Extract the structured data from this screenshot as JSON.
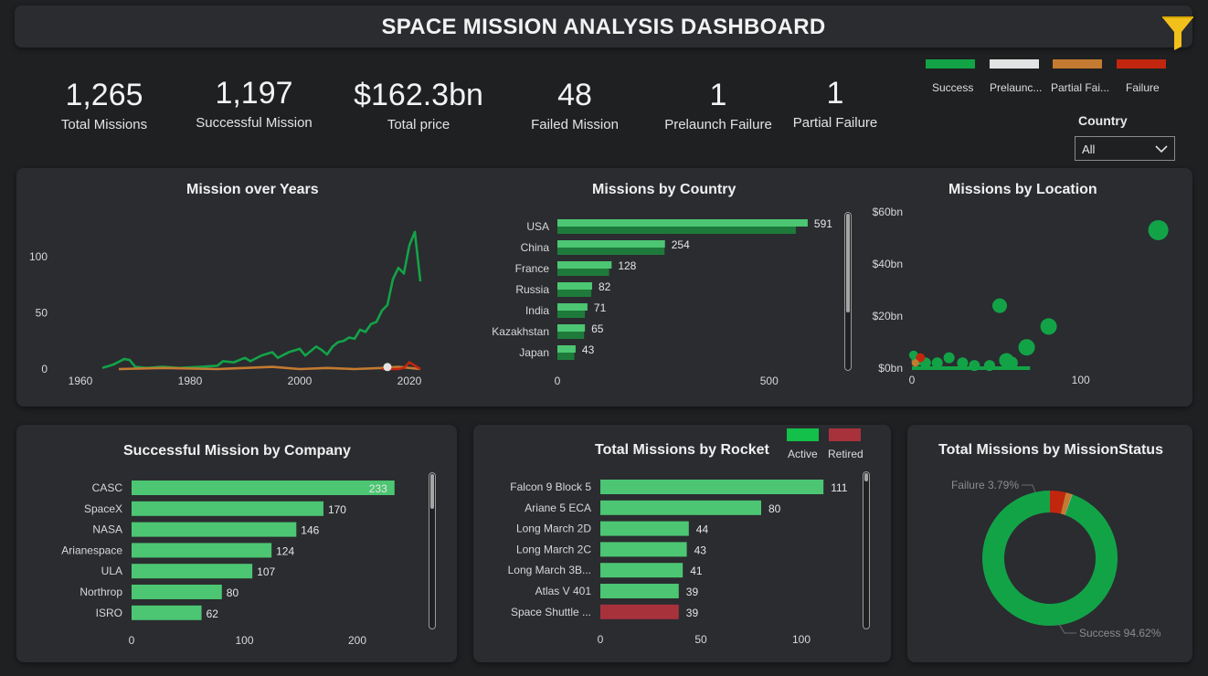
{
  "header": {
    "title": "SPACE MISSION ANALYSIS DASHBOARD"
  },
  "kpis": [
    {
      "value": "1,265",
      "label": "Total Missions"
    },
    {
      "value": "1,197",
      "label": "Successful Mission"
    },
    {
      "value": "$162.3bn",
      "label": "Total price"
    },
    {
      "value": "48",
      "label": "Failed Mission"
    },
    {
      "value": "1",
      "label": "Prelaunch Failure"
    },
    {
      "value": "1",
      "label": "Partial Failure"
    }
  ],
  "status_legend": [
    {
      "label": "Success",
      "color": "#13a347"
    },
    {
      "label": "Prelaunc...",
      "color": "#e3e3e3"
    },
    {
      "label": "Partial Fai...",
      "color": "#c47a30"
    },
    {
      "label": "Failure",
      "color": "#c2260f"
    }
  ],
  "slicer": {
    "label": "Country",
    "value": "All"
  },
  "colors": {
    "success": "#13a347",
    "bar_green": "#4cc672",
    "bar_dark": "#1e7a3a",
    "retired": "#a8323c",
    "failure": "#c2260f",
    "partial": "#c47a30"
  },
  "chart_data": [
    {
      "id": "mission_over_years",
      "type": "line",
      "title": "Mission over Years",
      "xticks": [
        "1960",
        "1980",
        "2000",
        "2020"
      ],
      "yticks": [
        "0",
        "50",
        "100"
      ],
      "xlim": [
        1960,
        2023
      ],
      "ylim": [
        0,
        130
      ],
      "series": [
        {
          "color": "#13a347",
          "x": [
            1964,
            1966,
            1968,
            1969,
            1970,
            1972,
            1975,
            1978,
            1982,
            1985,
            1986,
            1988,
            1990,
            1991,
            1993,
            1995,
            1996,
            1998,
            2000,
            2001,
            2003,
            2004,
            2005,
            2006,
            2007,
            2008,
            2009,
            2010,
            2011,
            2012,
            2013,
            2014,
            2015,
            2016,
            2017,
            2018,
            2019,
            2020,
            2021,
            2022
          ],
          "y": [
            1,
            4,
            9,
            8,
            2,
            1,
            2,
            1,
            2,
            3,
            7,
            6,
            10,
            7,
            12,
            15,
            10,
            15,
            18,
            12,
            20,
            17,
            13,
            20,
            24,
            25,
            28,
            27,
            35,
            33,
            40,
            42,
            52,
            57,
            80,
            90,
            85,
            110,
            122,
            78
          ]
        },
        {
          "color": "#c47a30",
          "x": [
            1967,
            1975,
            1985,
            1990,
            1995,
            2000,
            2005,
            2010,
            2015,
            2018,
            2020,
            2022
          ],
          "y": [
            0,
            1,
            0,
            1,
            2,
            0,
            1,
            0,
            1,
            2,
            1,
            0
          ]
        },
        {
          "color": "#c2260f",
          "x": [
            2015,
            2016,
            2017,
            2018,
            2019,
            2020,
            2021,
            2022
          ],
          "y": [
            0,
            0,
            0,
            0,
            1,
            6,
            3,
            0
          ]
        },
        {
          "color": "#e3e3e3",
          "x": [
            2016
          ],
          "y": [
            1
          ]
        }
      ]
    },
    {
      "id": "missions_by_country",
      "type": "bar",
      "title": "Missions by Country",
      "categories": [
        "USA",
        "China",
        "France",
        "Russia",
        "India",
        "Kazakhstan",
        "Japan"
      ],
      "series": [
        {
          "values": [
            591,
            254,
            128,
            82,
            71,
            65,
            43
          ]
        },
        {
          "values": [
            563,
            253,
            122,
            80,
            65,
            63,
            40
          ]
        }
      ],
      "xticks": [
        "0",
        "500"
      ],
      "xlim": [
        0,
        630
      ]
    },
    {
      "id": "missions_by_location",
      "type": "scatter",
      "title": "Missions by Location",
      "yticks": [
        "$0bn",
        "$20bn",
        "$40bn",
        "$60bn"
      ],
      "xticks": [
        "0",
        "100"
      ],
      "xlim": [
        0,
        150
      ],
      "ylim": [
        0,
        60
      ],
      "points": [
        {
          "x": 146,
          "y": 53,
          "r": 11,
          "c": "#13a347"
        },
        {
          "x": 52,
          "y": 24,
          "r": 8,
          "c": "#13a347"
        },
        {
          "x": 81,
          "y": 16,
          "r": 9,
          "c": "#13a347"
        },
        {
          "x": 68,
          "y": 8,
          "r": 9,
          "c": "#13a347"
        },
        {
          "x": 56,
          "y": 3,
          "r": 8,
          "c": "#13a347"
        },
        {
          "x": 59,
          "y": 2,
          "r": 7,
          "c": "#13a347"
        },
        {
          "x": 46,
          "y": 1,
          "r": 6,
          "c": "#13a347"
        },
        {
          "x": 37,
          "y": 1,
          "r": 6,
          "c": "#13a347"
        },
        {
          "x": 30,
          "y": 2,
          "r": 6,
          "c": "#13a347"
        },
        {
          "x": 22,
          "y": 4,
          "r": 6,
          "c": "#13a347"
        },
        {
          "x": 15,
          "y": 2,
          "r": 6,
          "c": "#13a347"
        },
        {
          "x": 8,
          "y": 2,
          "r": 6,
          "c": "#13a347"
        },
        {
          "x": 3,
          "y": 3,
          "r": 6,
          "c": "#13a347"
        },
        {
          "x": 1,
          "y": 5,
          "r": 5,
          "c": "#13a347"
        },
        {
          "x": 5,
          "y": 4,
          "r": 5,
          "c": "#c2260f"
        },
        {
          "x": 2,
          "y": 2,
          "r": 4,
          "c": "#c47a30"
        }
      ]
    },
    {
      "id": "successful_mission_by_company",
      "type": "bar",
      "title": "Successful Mission by Company",
      "categories": [
        "CASC",
        "SpaceX",
        "NASA",
        "Arianespace",
        "ULA",
        "Northrop",
        "ISRO"
      ],
      "values": [
        233,
        170,
        146,
        124,
        107,
        80,
        62
      ],
      "xticks": [
        "0",
        "100",
        "200"
      ],
      "xlim": [
        0,
        250
      ]
    },
    {
      "id": "total_missions_by_rocket",
      "type": "bar",
      "title": "Total Missions by Rocket",
      "legend": [
        "Active",
        "Retired"
      ],
      "categories": [
        "Falcon 9 Block 5",
        "Ariane 5 ECA",
        "Long March 2D",
        "Long March 2C",
        "Long March 3B...",
        "Atlas V 401",
        "Space Shuttle ..."
      ],
      "values": [
        111,
        80,
        44,
        43,
        41,
        39,
        39
      ],
      "status": [
        "Active",
        "Active",
        "Active",
        "Active",
        "Active",
        "Active",
        "Retired"
      ],
      "xticks": [
        "0",
        "50",
        "100"
      ],
      "xlim": [
        0,
        120
      ]
    },
    {
      "id": "total_missions_by_status",
      "type": "pie",
      "title": "Total Missions by MissionStatus",
      "slices": [
        {
          "label": "Success",
          "value": 94.62,
          "color": "#13a347"
        },
        {
          "label": "Failure",
          "value": 3.79,
          "color": "#c2260f"
        },
        {
          "label": "Partial Failure",
          "value": 1.5,
          "color": "#c47a30"
        },
        {
          "label": "Prelaunch Failure",
          "value": 0.09,
          "color": "#e3e3e3"
        }
      ],
      "labels": [
        "Failure 3.79%",
        "Success 94.62%"
      ]
    }
  ]
}
